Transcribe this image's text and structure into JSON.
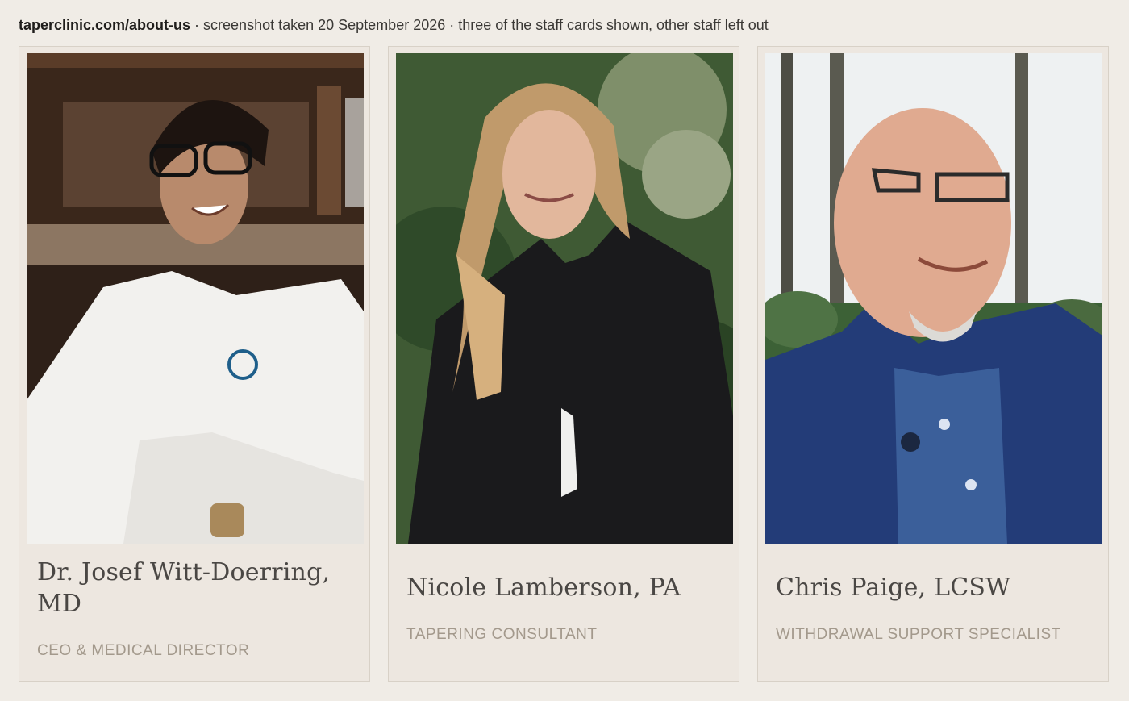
{
  "caption": {
    "url": "taperclinic.com/about-us",
    "note": " · screenshot taken 20 September 2026 · three of the staff cards shown, other staff left out"
  },
  "staff": [
    {
      "name": "Dr. Josef Witt-Doerring, MD",
      "role": "CEO & MEDICAL DIRECTOR"
    },
    {
      "name": "Nicole Lamberson, PA",
      "role": "TAPERING CONSULTANT"
    },
    {
      "name": "Chris Paige, LCSW",
      "role": "WITHDRAWAL SUPPORT SPECIALIST"
    }
  ],
  "colors": {
    "page_background": "#f0ece6",
    "card_background": "#ede7e0",
    "card_border": "#d8d1c7",
    "name_text": "#4a4744",
    "role_text": "#a3998c"
  }
}
